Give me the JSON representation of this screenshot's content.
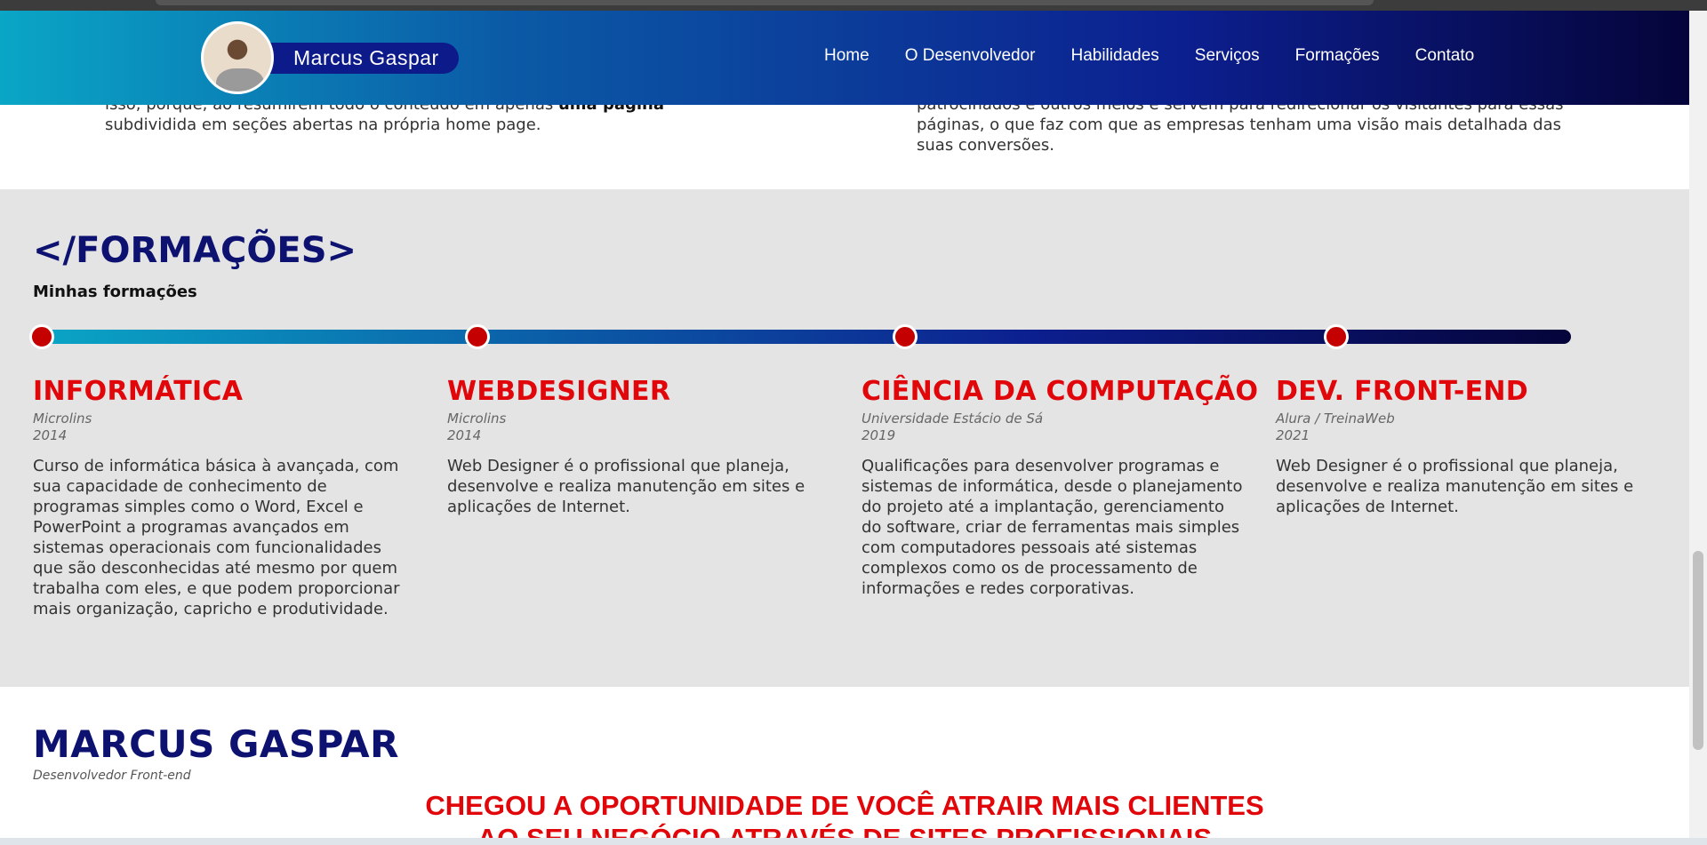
{
  "header": {
    "brand_name": "Marcus Gaspar",
    "nav": [
      "Home",
      "O Desenvolvedor",
      "Habilidades",
      "Serviços",
      "Formações",
      "Contato"
    ]
  },
  "top_section": {
    "left_text_prefix": "isso, porque, ao resumirem todo o conteúdo em apenas ",
    "left_text_bold": "uma página",
    "left_text_rest": "subdividida em seções abertas na própria home page.",
    "right_text": "patrocinados e outros meios e servem para redirecionar os visitantes para essas páginas, o que faz com que as empresas tenham uma visão mais detalhada das suas conversões."
  },
  "formacoes": {
    "title": "</FORMAÇÕES>",
    "subtitle": "Minhas formações",
    "courses": [
      {
        "title": "INFORMÁTICA",
        "institution": "Microlins",
        "year": "2014",
        "description": "Curso de informática básica à avançada, com sua capacidade de conhecimento de programas simples como o Word, Excel e PowerPoint a programas avançados em sistemas operacionais com funcionalidades que são desconhecidas até mesmo por quem trabalha com eles, e que podem proporcionar mais organização, capricho e produtividade."
      },
      {
        "title": "WEBDESIGNER",
        "institution": "Microlins",
        "year": "2014",
        "description": "Web Designer é o profissional que planeja, desenvolve e realiza manutenção em sites e aplicações de Internet."
      },
      {
        "title": "CIÊNCIA DA COMPUTAÇÃO",
        "institution": "Universidade Estácio de Sá",
        "year": "2019",
        "description": "Qualificações para desenvolver programas e sistemas de informática, desde o planejamento do projeto até a implantação,  gerenciamento do software, criar de ferramentas mais simples com computadores pessoais até sistemas complexos como os de processamento de informações e redes corporativas."
      },
      {
        "title": "DEV. FRONT-END",
        "institution": "Alura / TreinaWeb",
        "year": "2021",
        "description": "Web Designer é o profissional que planeja, desenvolve e realiza manutenção em sites e aplicações de Internet."
      }
    ]
  },
  "bottom": {
    "name": "MARCUS GASPAR",
    "role": "Desenvolvedor Front-end",
    "cta_line1": "CHEGOU A OPORTUNIDADE DE VOCÊ ATRAIR MAIS CLIENTES",
    "cta_line2": "AO SEU NEGÓCIO ATRAVÉS DE SITES PROFISSIONAIS"
  },
  "colors": {
    "accent_red": "#e0060a",
    "navy": "#0d1270",
    "timeline_dot": "#c40000"
  }
}
